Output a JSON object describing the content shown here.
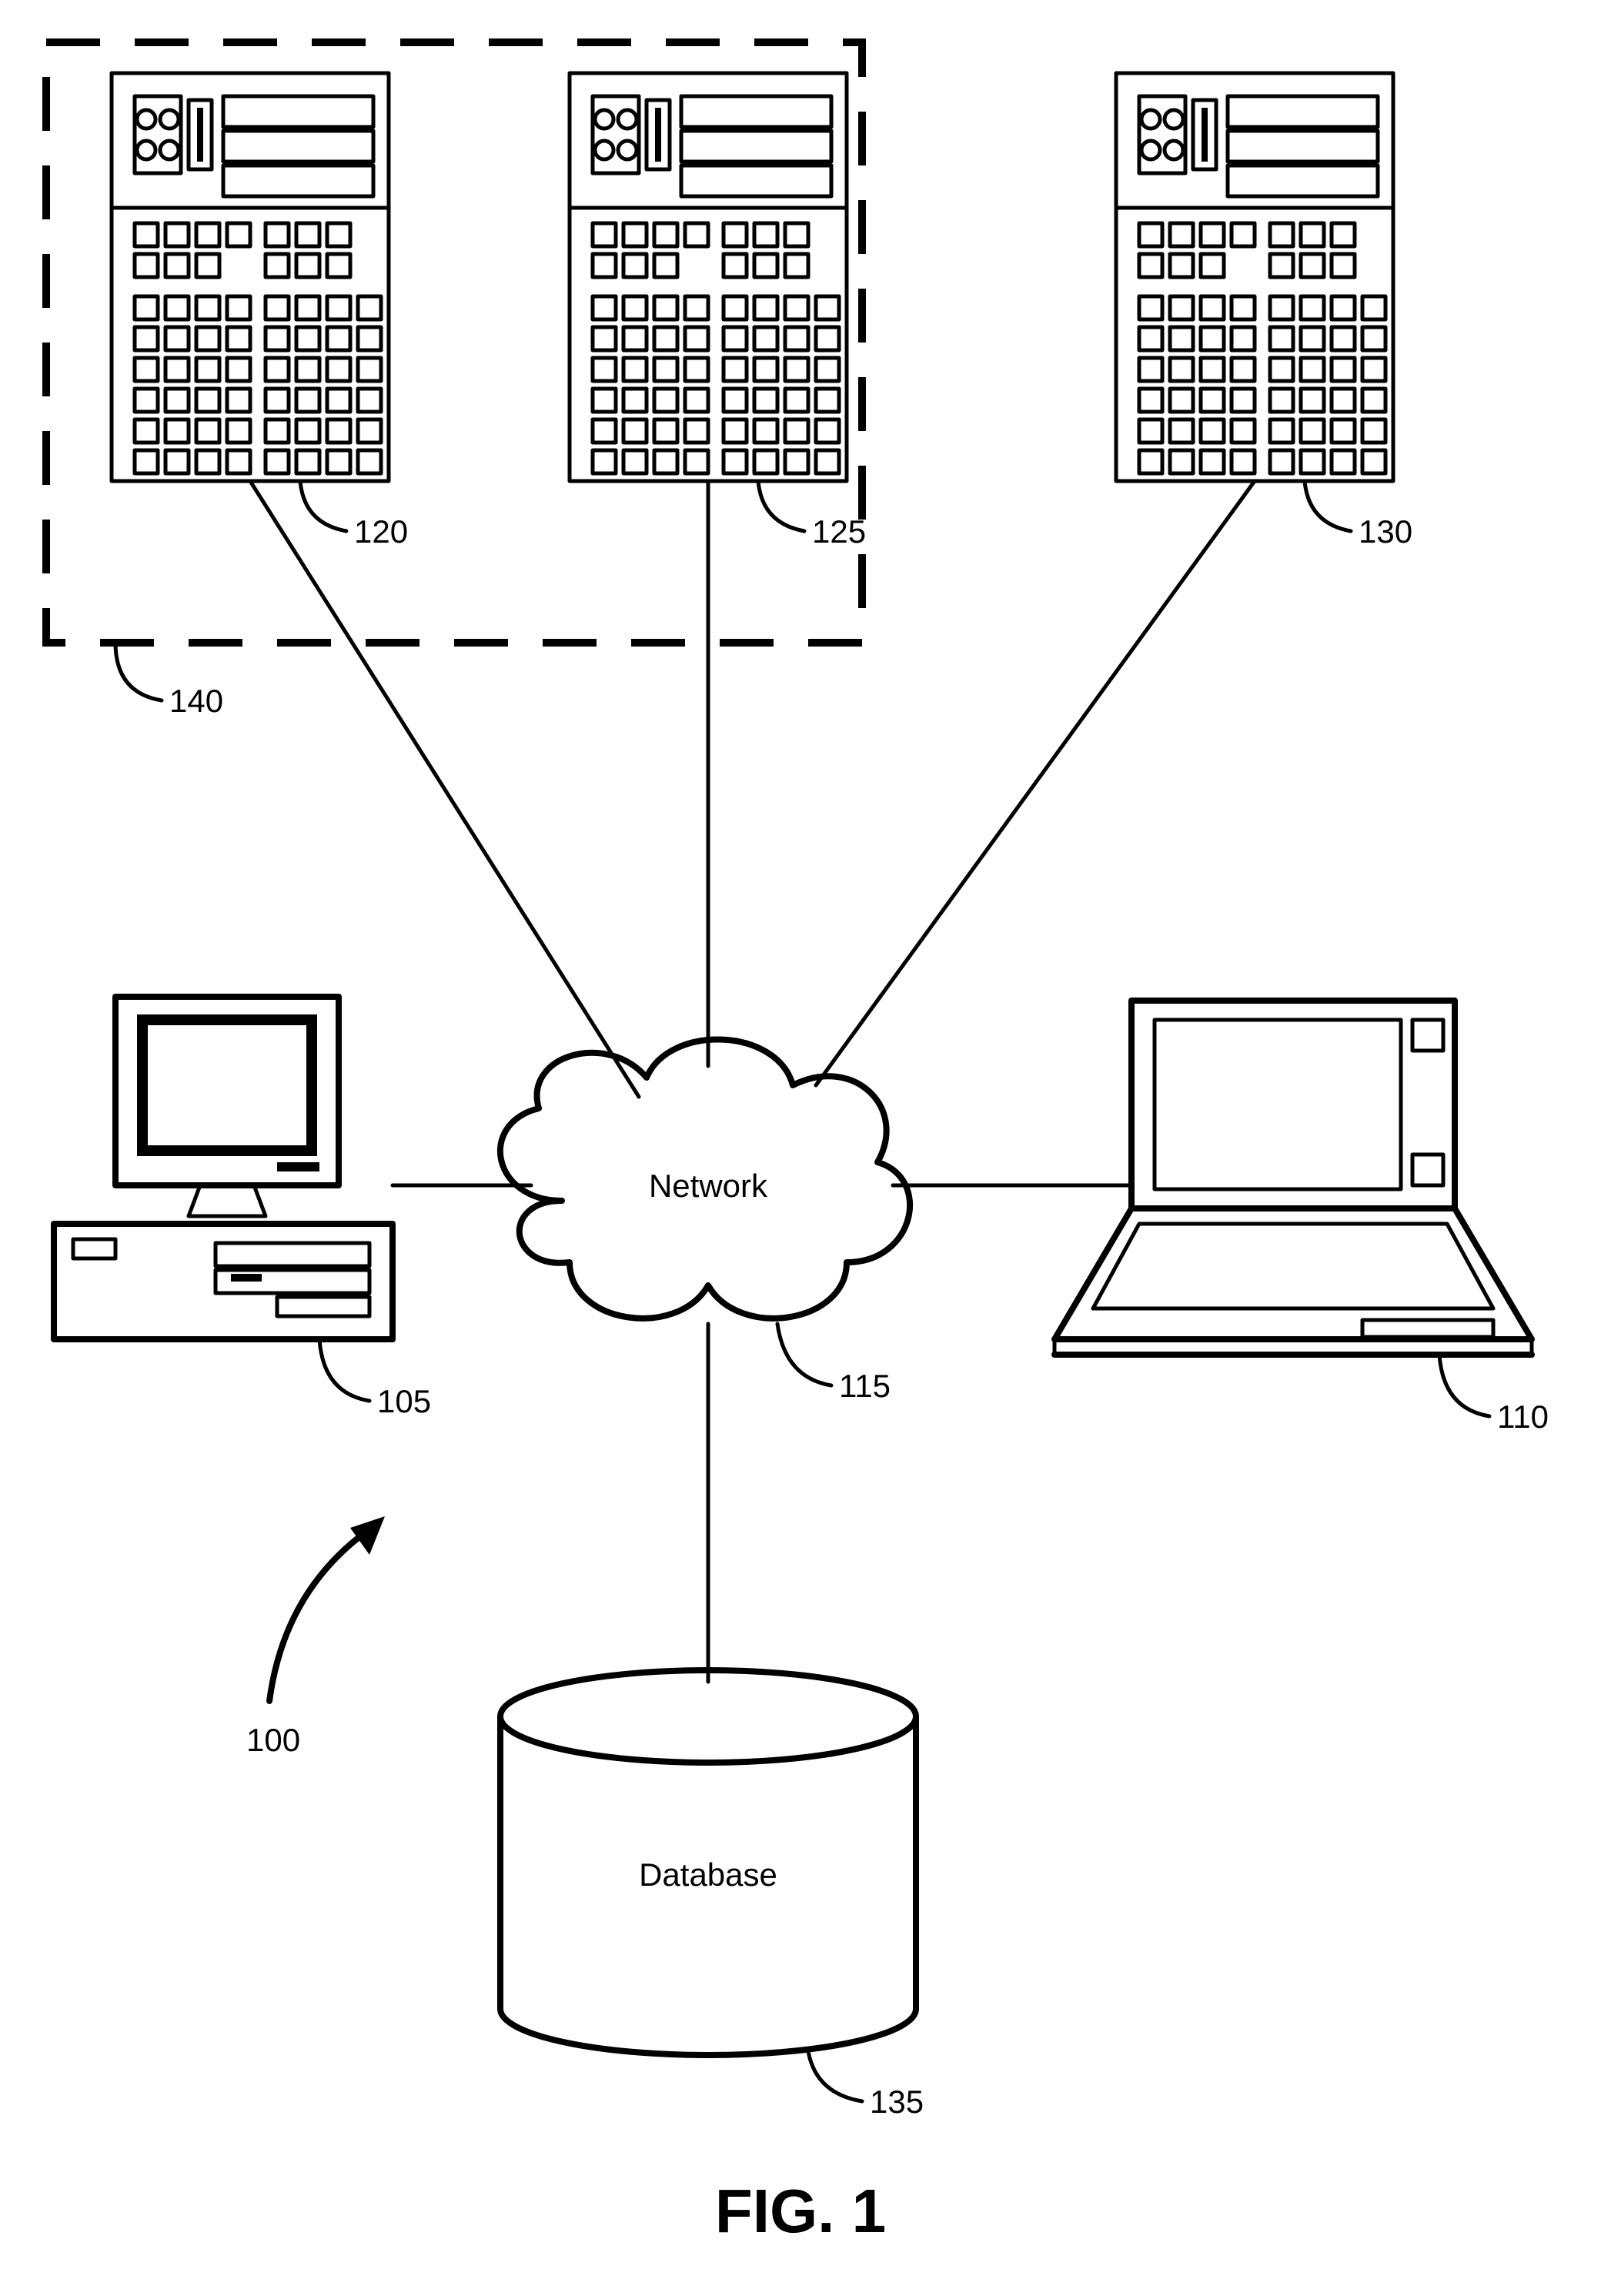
{
  "figure_label": "FIG. 1",
  "network_label": "Network",
  "database_label": "Database",
  "refs": {
    "system": "100",
    "desktop": "105",
    "laptop": "110",
    "network": "115",
    "server1": "120",
    "server2": "125",
    "server3": "130",
    "database": "135",
    "servergroup": "140"
  }
}
